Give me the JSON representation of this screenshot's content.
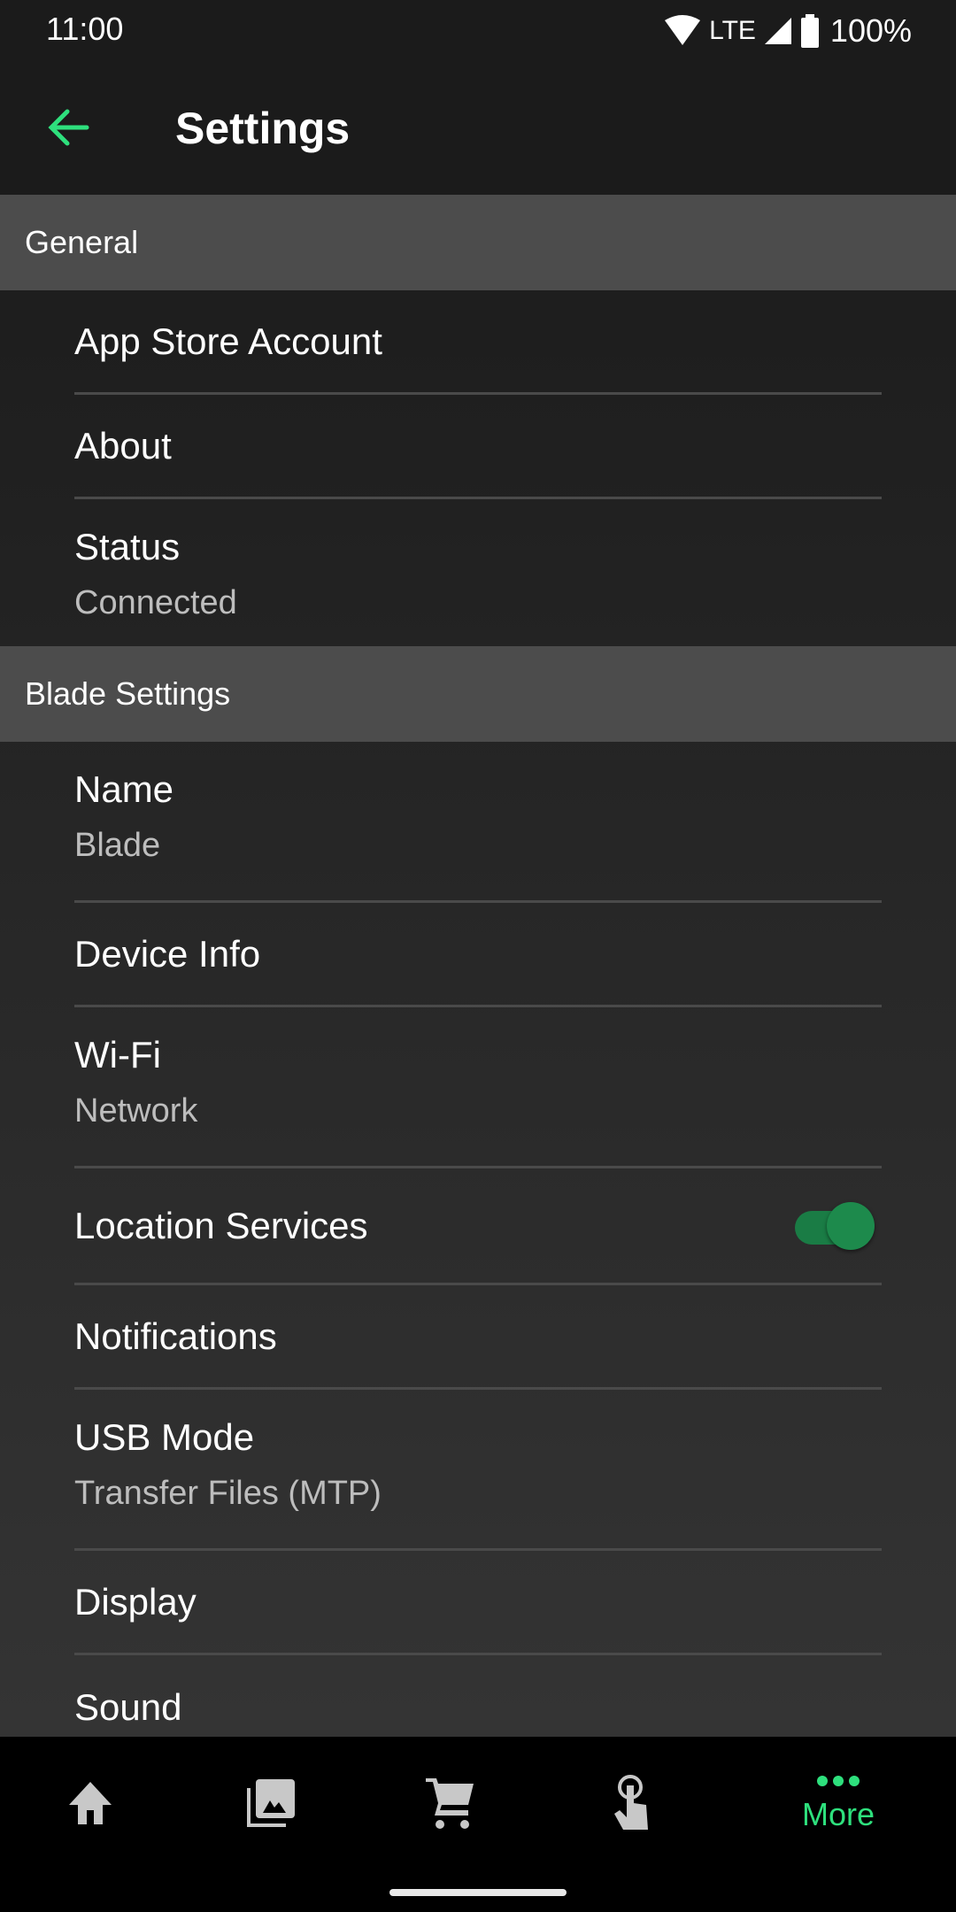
{
  "status_bar": {
    "time": "11:00",
    "network": "LTE",
    "battery": "100%"
  },
  "app_bar": {
    "title": "Settings",
    "back_icon": "arrow-back-icon"
  },
  "colors": {
    "accent": "#2ee07d",
    "toggle_on": "#1d8a4c",
    "section_header_bg": "#4c4c4c"
  },
  "sections": [
    {
      "header": "General",
      "items": [
        {
          "label": "App Store Account"
        },
        {
          "label": "About"
        },
        {
          "label": "Status",
          "value": "Connected"
        }
      ]
    },
    {
      "header": "Blade Settings",
      "items": [
        {
          "label": "Name",
          "value": "Blade"
        },
        {
          "label": "Device Info"
        },
        {
          "label": "Wi-Fi",
          "value": "Network"
        },
        {
          "label": "Location Services",
          "toggle": true
        },
        {
          "label": "Notifications"
        },
        {
          "label": "USB Mode",
          "value": "Transfer Files (MTP)"
        },
        {
          "label": "Display"
        },
        {
          "label": "Sound"
        }
      ]
    }
  ],
  "bottom_nav": {
    "items": [
      {
        "icon": "home-icon"
      },
      {
        "icon": "gallery-icon"
      },
      {
        "icon": "cart-icon"
      },
      {
        "icon": "touch-icon"
      },
      {
        "icon": "more-icon",
        "label": "More",
        "active": true
      }
    ]
  }
}
